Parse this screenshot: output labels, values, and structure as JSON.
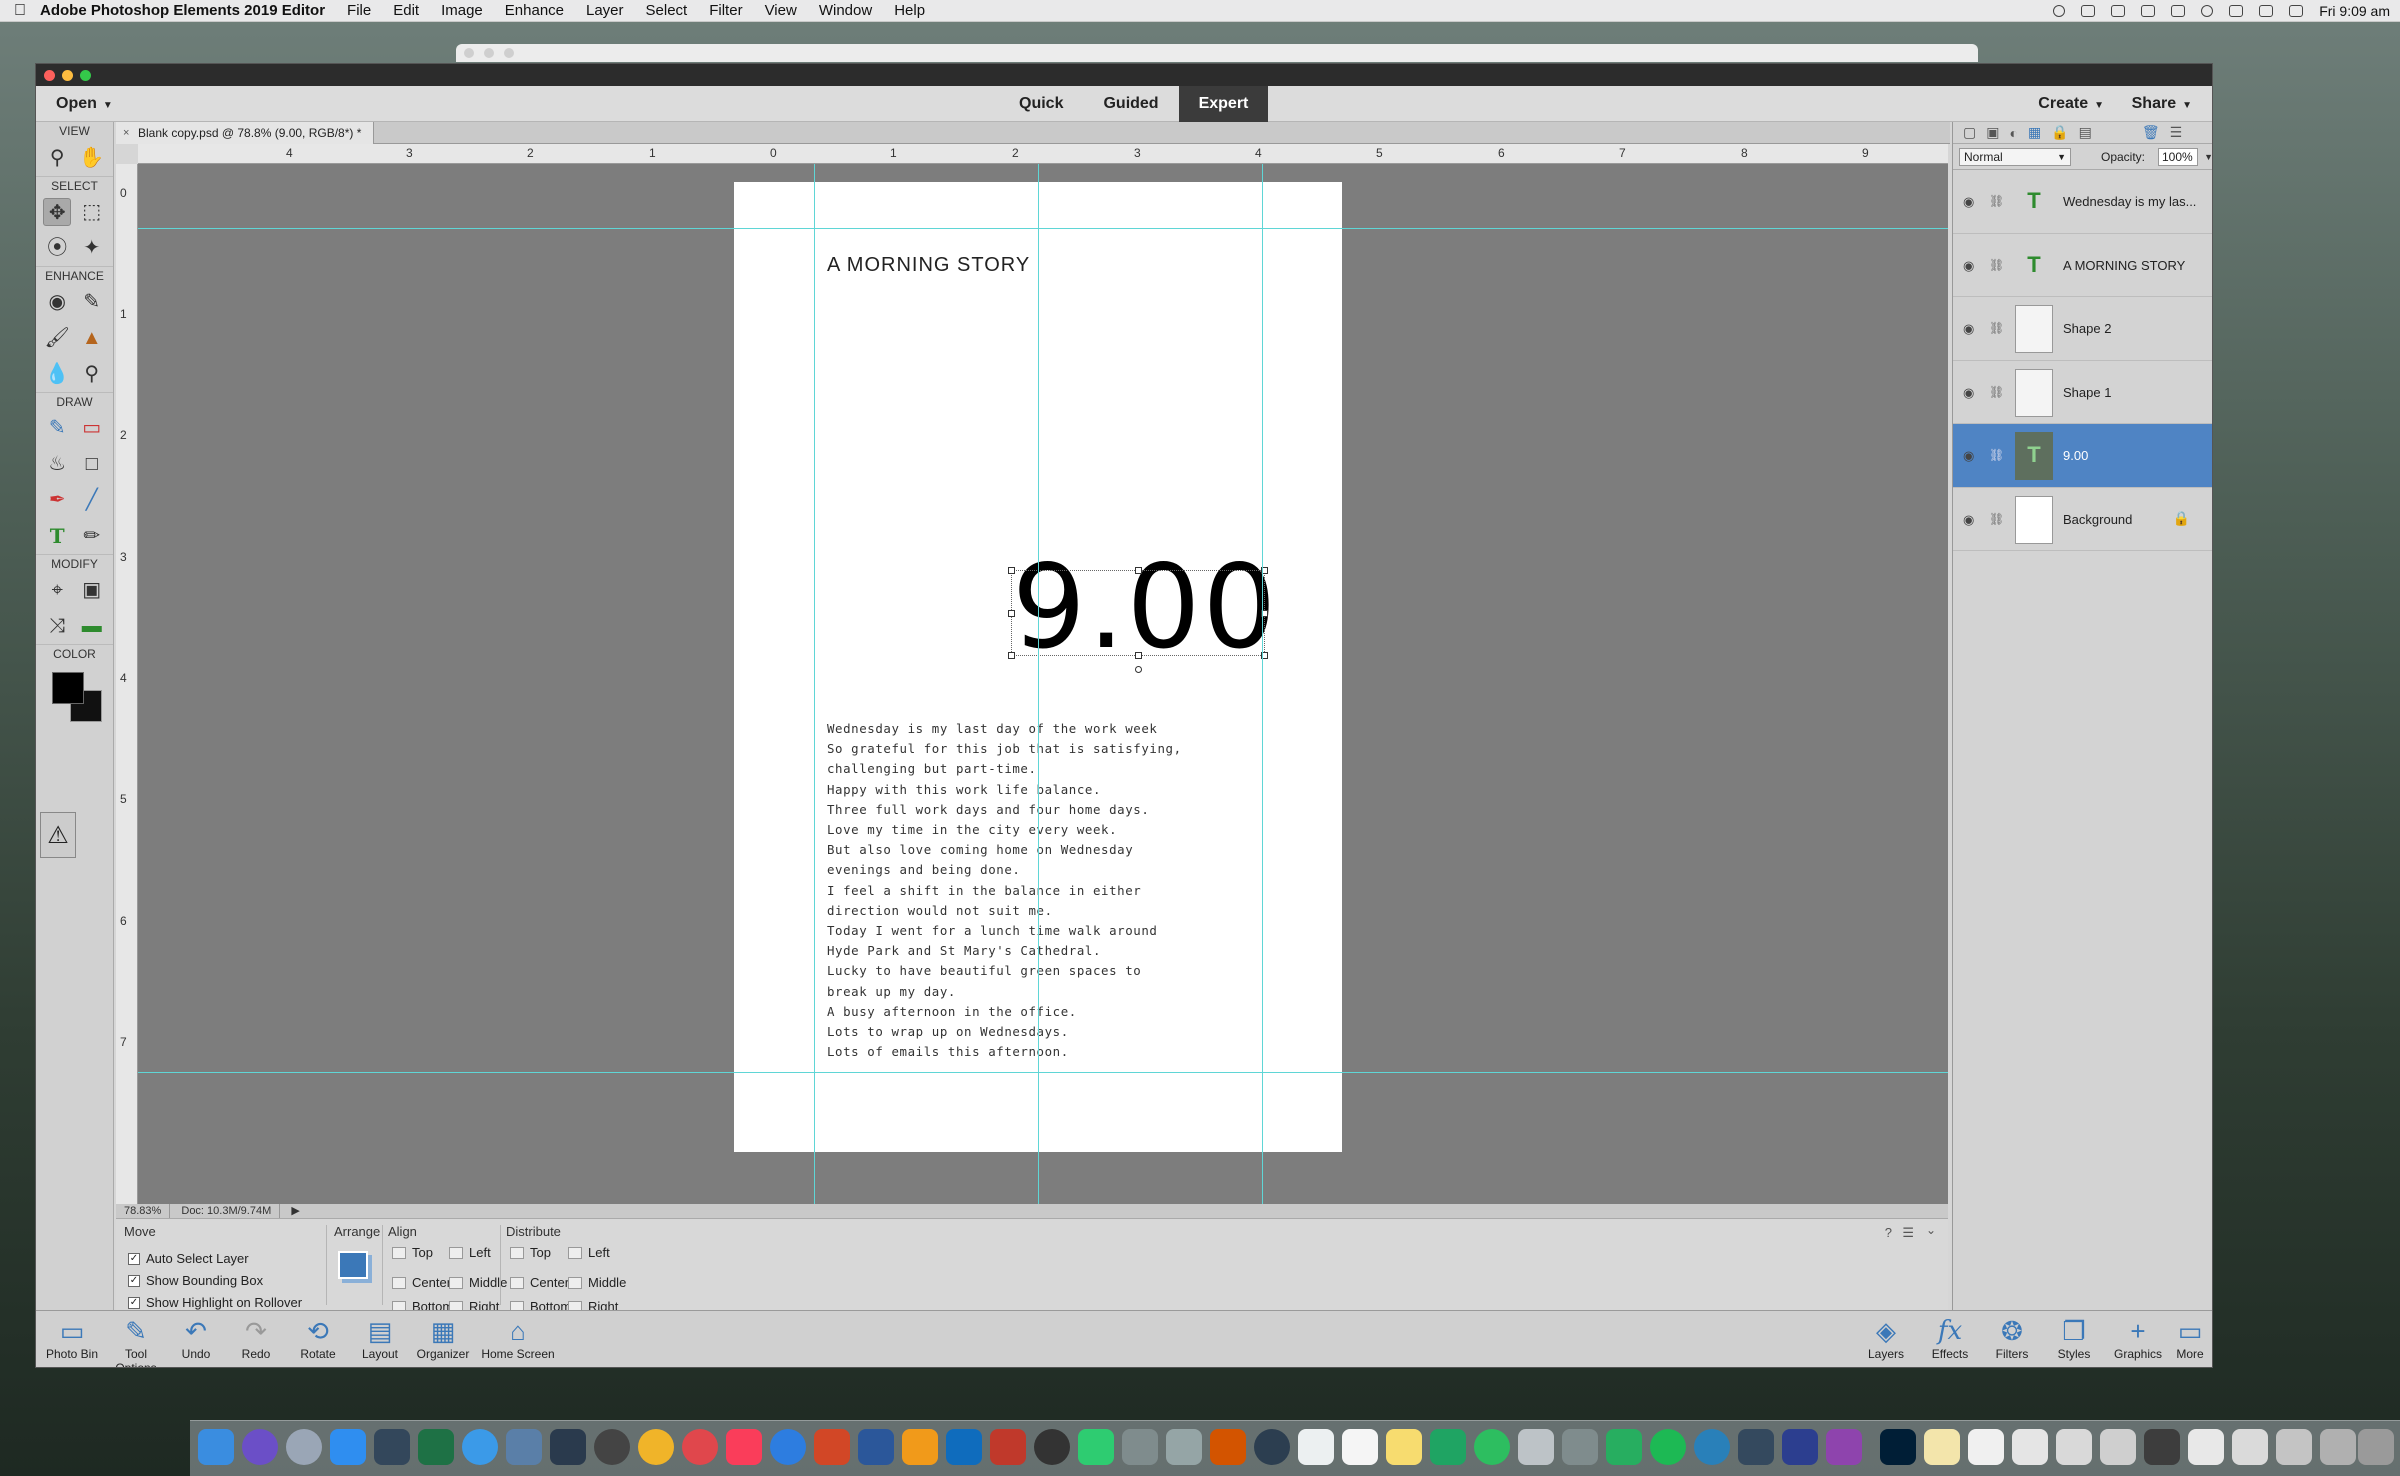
{
  "menubar": {
    "app_name": "Adobe Photoshop Elements 2019 Editor",
    "items": [
      "File",
      "Edit",
      "Image",
      "Enhance",
      "Layer",
      "Select",
      "Filter",
      "View",
      "Window",
      "Help"
    ],
    "clock": "Fri 9:09 am"
  },
  "topbar": {
    "open_label": "Open",
    "modes": [
      "Quick",
      "Guided",
      "Expert"
    ],
    "active_mode": "Expert",
    "create_label": "Create",
    "share_label": "Share"
  },
  "document": {
    "tab_title": "Blank copy.psd @ 78.8% (9.00, RGB/8*) *"
  },
  "toolbar": {
    "sections": {
      "view": "VIEW",
      "select": "SELECT",
      "enhance": "ENHANCE",
      "draw": "DRAW",
      "modify": "MODIFY",
      "color": "COLOR"
    },
    "colors": {
      "foreground": "#000000",
      "background": "#111111"
    }
  },
  "rulers": {
    "horizontal": [
      "4",
      "3",
      "2",
      "1",
      "0",
      "1",
      "2",
      "3",
      "4",
      "5",
      "6",
      "7",
      "8",
      "9"
    ],
    "vertical": [
      "0",
      "1",
      "2",
      "3",
      "4",
      "5",
      "6",
      "7"
    ]
  },
  "canvas": {
    "title": "A MORNING STORY",
    "time": "9.00",
    "poem": [
      "Wednesday is my last day of the work week",
      "So grateful for this job that is satisfying,",
      "challenging but part-time.",
      "Happy with this work life balance.",
      "Three full work days and four home days.",
      "Love my time in the city every week.",
      "But also love coming home on Wednesday",
      "evenings and being done.",
      "I feel a shift in the balance in either",
      "direction would not suit me.",
      "Today I went for a lunch time walk around",
      "Hyde Park and St Mary's Cathedral.",
      "Lucky to have beautiful green spaces to",
      "break up my day.",
      "A busy afternoon in the office.",
      "Lots to wrap up on Wednesdays.",
      "Lots of emails this afternoon."
    ]
  },
  "statusbar": {
    "zoom": "78.83%",
    "doc_size": "Doc: 10.3M/9.74M"
  },
  "options": {
    "move": {
      "title": "Move",
      "auto_select": "Auto Select Layer",
      "bounding_box": "Show Bounding Box",
      "highlight": "Show Highlight on Rollover"
    },
    "arrange": {
      "title": "Arrange"
    },
    "align": {
      "title": "Align",
      "top": "Top",
      "center": "Center",
      "bottom": "Bottom",
      "left": "Left",
      "middle": "Middle",
      "right": "Right"
    },
    "distribute": {
      "title": "Distribute",
      "top": "Top",
      "center": "Center",
      "bottom": "Bottom",
      "left": "Left",
      "middle": "Middle",
      "right": "Right"
    }
  },
  "taskbar": {
    "left": [
      "Photo Bin",
      "Tool Options",
      "Undo",
      "Redo",
      "Rotate",
      "Layout",
      "Organizer",
      "Home Screen"
    ],
    "right": [
      "Layers",
      "Effects",
      "Filters",
      "Styles",
      "Graphics",
      "More"
    ]
  },
  "layers_panel": {
    "blend_mode": "Normal",
    "opacity_label": "Opacity:",
    "opacity_value": "100%",
    "layers": [
      {
        "name": "Wednesday is my las...",
        "kind": "text"
      },
      {
        "name": "A MORNING STORY",
        "kind": "text"
      },
      {
        "name": "Shape 2",
        "kind": "shape"
      },
      {
        "name": "Shape 1",
        "kind": "shape"
      },
      {
        "name": "9.00",
        "kind": "text",
        "active": true
      },
      {
        "name": "Background",
        "kind": "background"
      }
    ]
  },
  "accent_color": "#4f84c4"
}
